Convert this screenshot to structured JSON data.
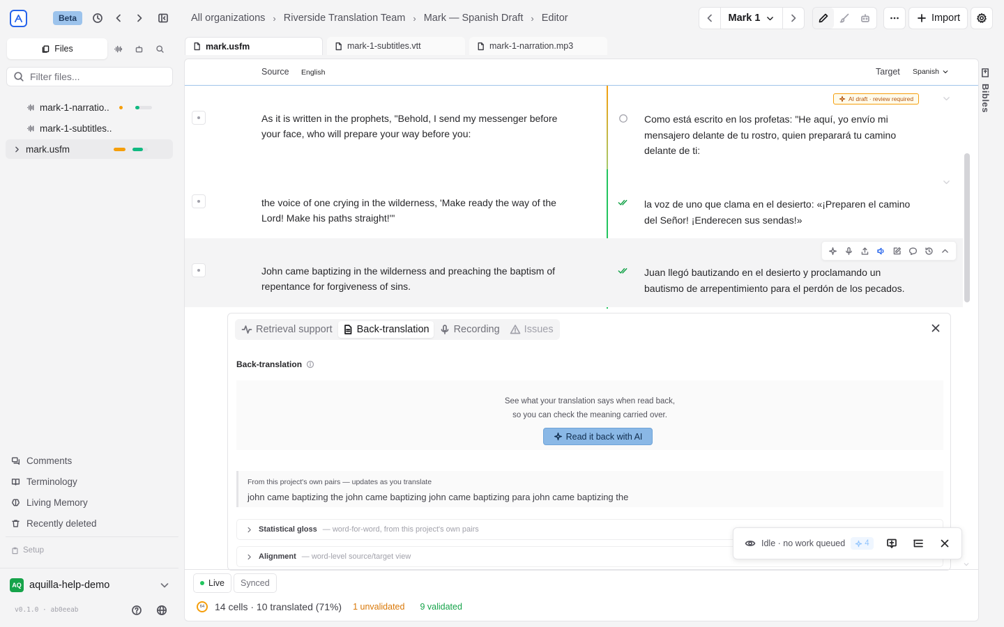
{
  "app": {
    "beta_label": "Beta",
    "breadcrumb": [
      "All organizations",
      "Riverside Translation Team",
      "Mark — Spanish Draft",
      "Editor"
    ],
    "chapter": "Mark 1",
    "import_label": "Import"
  },
  "sidebar": {
    "files_tab": "Files",
    "filter_placeholder": "Filter files...",
    "files": [
      {
        "name": "mark-1-narratio...",
        "progress_orange": 0.05,
        "progress_green": 0.08
      },
      {
        "name": "mark-1-subtitles...",
        "progress_orange": 0,
        "progress_green": 0
      },
      {
        "name": "mark.usfm",
        "progress_orange": 0.1,
        "progress_green": 0.1
      }
    ],
    "links": [
      "Comments",
      "Terminology",
      "Living Memory",
      "Recently deleted"
    ],
    "setup_label": "Setup",
    "project_initials": "AQ",
    "project_name": "aquilla-help-demo",
    "version": "v0.1.0 · ab0eeab"
  },
  "tabs": [
    "mark.usfm",
    "mark-1-subtitles.vtt",
    "mark-1-narration.mp3"
  ],
  "editor": {
    "source_label": "Source",
    "source_lang": "English",
    "target_label": "Target",
    "target_lang": "Spanish",
    "ai_badge": "AI draft · review required",
    "cells": [
      {
        "source": "As it is written in the prophets, \"Behold, I send my messenger before your face, who will prepare your way before you:",
        "target": "Como está escrito en los profetas: \"He aquí, yo envío mi mensajero delante de tu rostro, quien preparará tu camino delante de ti:",
        "status": "draft"
      },
      {
        "source": "the voice of one crying in the wilderness, 'Make ready the way of the Lord! Make his paths straight!'\"",
        "target": "la voz de uno que clama en el desierto: «¡Preparen el camino del Señor! ¡Enderecen sus sendas!»",
        "status": "validated"
      },
      {
        "source": "John came baptizing in the wilderness and preaching the baptism of repentance for forgiveness of sins.",
        "target": "Juan llegó bautizando en el desierto y proclamando un bautismo de arrepentimiento para el perdón de los pecados.",
        "status": "validated"
      }
    ]
  },
  "panel": {
    "tabs": [
      "Retrieval support",
      "Back-translation",
      "Recording",
      "Issues"
    ],
    "title": "Back-translation",
    "desc_line1": "See what your translation says when read back,",
    "desc_line2": "so you can check the meaning carried over.",
    "read_button": "Read it back with AI",
    "pairs_heading": "From this project's own pairs — updates as you translate",
    "pairs_text": "john came baptizing the john came baptizing john came baptizing para john came baptizing the",
    "accordions": [
      {
        "title": "Statistical gloss",
        "desc": "— word-for-word, from this project's own pairs"
      },
      {
        "title": "Alignment",
        "desc": "— word-level source/target view"
      }
    ]
  },
  "status_popup": {
    "text": "Idle · no work queued",
    "ai_count": "4"
  },
  "footer": {
    "live": "Live",
    "synced": "Synced",
    "ring_value": "64",
    "stats": "14 cells · 10 translated (71%)",
    "unvalidated": "1 unvalidated",
    "validated": "9 validated"
  },
  "rail": {
    "bibles_label": "Bibles"
  },
  "colors": {
    "accent": "#2563eb",
    "draft_orange": "#f59e0b",
    "validated_green": "#16a34a",
    "unvalidated_text": "#d97706"
  }
}
